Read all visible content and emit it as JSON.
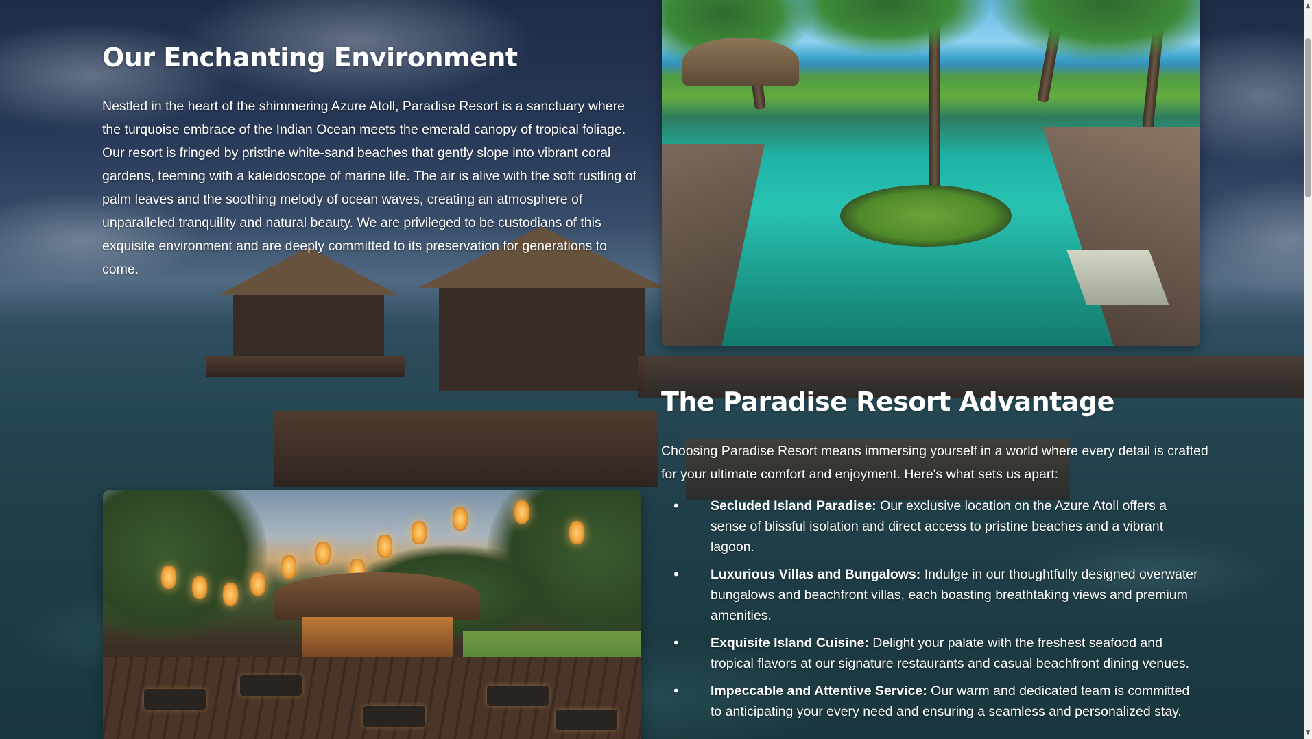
{
  "environment": {
    "title": "Our Enchanting Environment",
    "paragraph": "Nestled in the heart of the shimmering Azure Atoll, Paradise Resort is a sanctuary where the turquoise embrace of the Indian Ocean meets the emerald canopy of tropical foliage. Our resort is fringed by pristine white-sand beaches that gently slope into vibrant coral gardens, teeming with a kaleidoscope of marine life. The air is alive with the soft rustling of palm leaves and the soothing melody of ocean waves, creating an atmosphere of unparalleled tranquility and natural beauty. We are privileged to be custodians of this exquisite environment and are deeply committed to its preservation for generations to come."
  },
  "advantage": {
    "title": "The Paradise Resort Advantage",
    "intro": "Choosing Paradise Resort means immersing yourself in a world where every detail is crafted for your ultimate comfort and enjoyment. Here's what sets us apart:",
    "items": [
      {
        "bullet": "•",
        "heading": "Secluded Island Paradise:",
        "text": " Our exclusive location on the Azure Atoll offers a sense of blissful isolation and direct access to pristine beaches and a vibrant lagoon."
      },
      {
        "bullet": "•",
        "heading": "Luxurious Villas and Bungalows:",
        "text": " Indulge in our thoughtfully designed overwater bungalows and beachfront villas, each boasting breathtaking views and premium amenities."
      },
      {
        "bullet": "•",
        "heading": "Exquisite Island Cuisine:",
        "text": " Delight your palate with the freshest seafood and tropical flavors at our signature restaurants and casual beachfront dining venues."
      },
      {
        "bullet": "•",
        "heading": "Impeccable and Attentive Service:",
        "text": " Our warm and dedicated team is committed to anticipating your every need and ensuring a seamless and personalized stay."
      }
    ]
  },
  "scrollbar": {
    "up_icon": "▲",
    "down_icon": "▼"
  }
}
